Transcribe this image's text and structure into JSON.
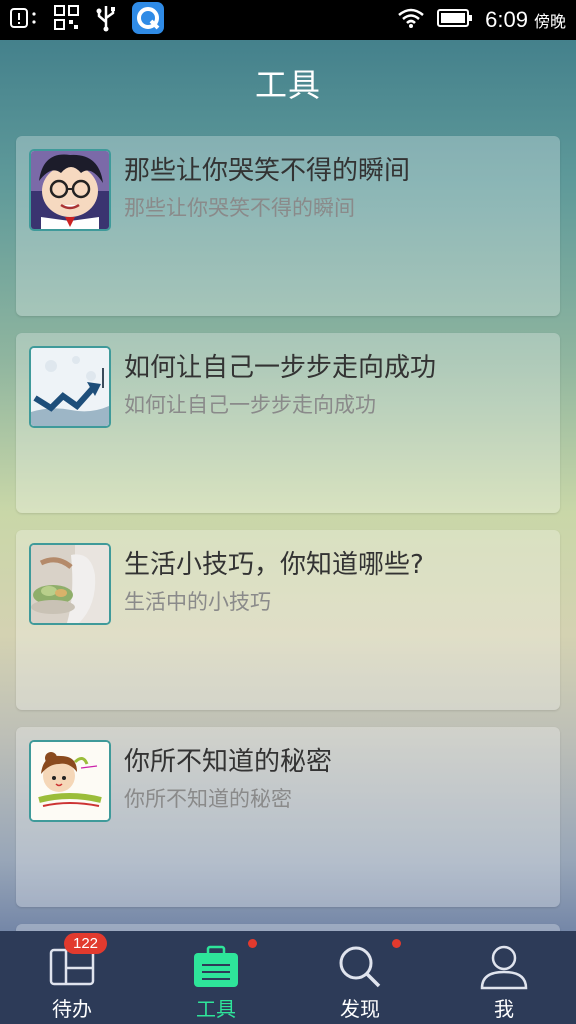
{
  "status_bar": {
    "time": "6:09",
    "period": "傍晚",
    "icons": [
      "notification-icon",
      "qr-code-icon",
      "usb-icon",
      "browser-app-icon",
      "wifi-icon",
      "battery-icon"
    ]
  },
  "header": {
    "title": "工具"
  },
  "cards": [
    {
      "title": "那些让你哭笑不得的瞬间",
      "subtitle": "那些让你哭笑不得的瞬间",
      "thumb": "cartoon-avatar"
    },
    {
      "title": "如何让自己一步步走向成功",
      "subtitle": "如何让自己一步步走向成功",
      "thumb": "growth-arrow"
    },
    {
      "title": "生活小技巧，你知道哪些?",
      "subtitle": "生活中的小技巧",
      "thumb": "cooking-photo"
    },
    {
      "title": "你所不知道的秘密",
      "subtitle": "你所不知道的秘密",
      "thumb": "secret-cartoon"
    }
  ],
  "tabbar": {
    "tabs": [
      {
        "label": "待办",
        "icon": "todo-icon",
        "badge": "122"
      },
      {
        "label": "工具",
        "icon": "briefcase-icon",
        "active": true
      },
      {
        "label": "发现",
        "icon": "search-icon"
      },
      {
        "label": "我",
        "icon": "person-icon"
      }
    ]
  },
  "colors": {
    "active_tab": "#2ee59a",
    "tabbar_bg": "#2d3b58",
    "badge": "#e23a2e"
  }
}
